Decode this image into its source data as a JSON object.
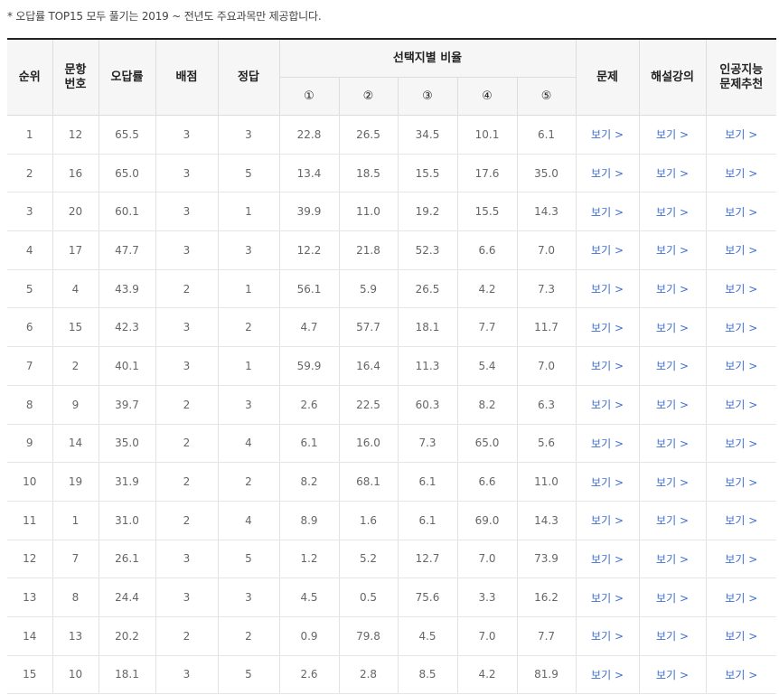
{
  "note": "* 오답률 TOP15 모두 풀기는 2019 ~ 전년도 주요과목만 제공합니다.",
  "headers": {
    "rank": "순위",
    "question_no": "문항\n번호",
    "wrong_rate": "오답률",
    "points": "배점",
    "answer": "정답",
    "choice_ratio": "선택지별 비율",
    "choices": [
      "①",
      "②",
      "③",
      "④",
      "⑤"
    ],
    "problem": "문제",
    "lecture": "해설강의",
    "ai": "인공지능\n문제추천"
  },
  "link_label": "보기 >",
  "rows": [
    {
      "rank": "1",
      "q": "12",
      "wrong": "65.5",
      "pts": "3",
      "ans": "3",
      "c": [
        "22.8",
        "26.5",
        "34.5",
        "10.1",
        "6.1"
      ]
    },
    {
      "rank": "2",
      "q": "16",
      "wrong": "65.0",
      "pts": "3",
      "ans": "5",
      "c": [
        "13.4",
        "18.5",
        "15.5",
        "17.6",
        "35.0"
      ]
    },
    {
      "rank": "3",
      "q": "20",
      "wrong": "60.1",
      "pts": "3",
      "ans": "1",
      "c": [
        "39.9",
        "11.0",
        "19.2",
        "15.5",
        "14.3"
      ]
    },
    {
      "rank": "4",
      "q": "17",
      "wrong": "47.7",
      "pts": "3",
      "ans": "3",
      "c": [
        "12.2",
        "21.8",
        "52.3",
        "6.6",
        "7.0"
      ]
    },
    {
      "rank": "5",
      "q": "4",
      "wrong": "43.9",
      "pts": "2",
      "ans": "1",
      "c": [
        "56.1",
        "5.9",
        "26.5",
        "4.2",
        "7.3"
      ]
    },
    {
      "rank": "6",
      "q": "15",
      "wrong": "42.3",
      "pts": "3",
      "ans": "2",
      "c": [
        "4.7",
        "57.7",
        "18.1",
        "7.7",
        "11.7"
      ]
    },
    {
      "rank": "7",
      "q": "2",
      "wrong": "40.1",
      "pts": "3",
      "ans": "1",
      "c": [
        "59.9",
        "16.4",
        "11.3",
        "5.4",
        "7.0"
      ]
    },
    {
      "rank": "8",
      "q": "9",
      "wrong": "39.7",
      "pts": "2",
      "ans": "3",
      "c": [
        "2.6",
        "22.5",
        "60.3",
        "8.2",
        "6.3"
      ]
    },
    {
      "rank": "9",
      "q": "14",
      "wrong": "35.0",
      "pts": "2",
      "ans": "4",
      "c": [
        "6.1",
        "16.0",
        "7.3",
        "65.0",
        "5.6"
      ]
    },
    {
      "rank": "10",
      "q": "19",
      "wrong": "31.9",
      "pts": "2",
      "ans": "2",
      "c": [
        "8.2",
        "68.1",
        "6.1",
        "6.6",
        "11.0"
      ]
    },
    {
      "rank": "11",
      "q": "1",
      "wrong": "31.0",
      "pts": "2",
      "ans": "4",
      "c": [
        "8.9",
        "1.6",
        "6.1",
        "69.0",
        "14.3"
      ]
    },
    {
      "rank": "12",
      "q": "7",
      "wrong": "26.1",
      "pts": "3",
      "ans": "5",
      "c": [
        "1.2",
        "5.2",
        "12.7",
        "7.0",
        "73.9"
      ]
    },
    {
      "rank": "13",
      "q": "8",
      "wrong": "24.4",
      "pts": "3",
      "ans": "3",
      "c": [
        "4.5",
        "0.5",
        "75.6",
        "3.3",
        "16.2"
      ]
    },
    {
      "rank": "14",
      "q": "13",
      "wrong": "20.2",
      "pts": "2",
      "ans": "2",
      "c": [
        "0.9",
        "79.8",
        "4.5",
        "7.0",
        "7.7"
      ]
    },
    {
      "rank": "15",
      "q": "10",
      "wrong": "18.1",
      "pts": "3",
      "ans": "5",
      "c": [
        "2.6",
        "2.8",
        "8.5",
        "4.2",
        "81.9"
      ]
    }
  ],
  "colors": {
    "link": "#3f6fd1",
    "header_bg": "#f6f6f6",
    "top_border": "#222222"
  }
}
